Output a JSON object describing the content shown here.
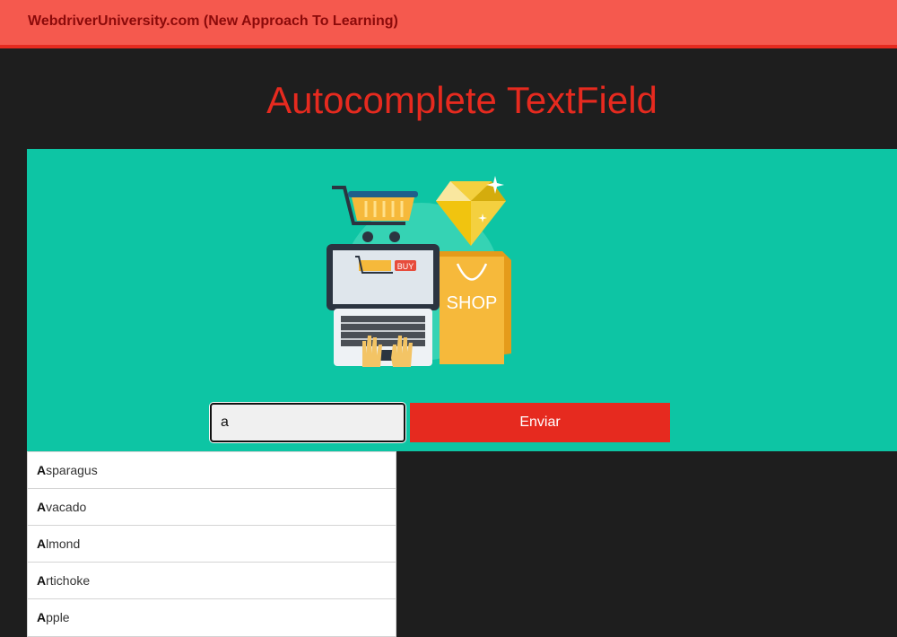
{
  "header": {
    "brand": "WebdriverUniversity.com (New Approach To Learning)"
  },
  "page": {
    "title": "Autocomplete TextField"
  },
  "illustration": {
    "buy_label": "BUY",
    "shop_label": "SHOP"
  },
  "search": {
    "value": "a",
    "submit_label": "Enviar"
  },
  "suggestions": [
    {
      "match": "A",
      "rest": "sparagus"
    },
    {
      "match": "A",
      "rest": "vacado"
    },
    {
      "match": "A",
      "rest": "lmond"
    },
    {
      "match": "A",
      "rest": "rtichoke"
    },
    {
      "match": "A",
      "rest": "pple"
    }
  ],
  "colors": {
    "header_bg": "#f5594e",
    "accent_red": "#e62a1f",
    "panel_teal": "#0dc5a4",
    "page_bg": "#1e1e1e"
  }
}
